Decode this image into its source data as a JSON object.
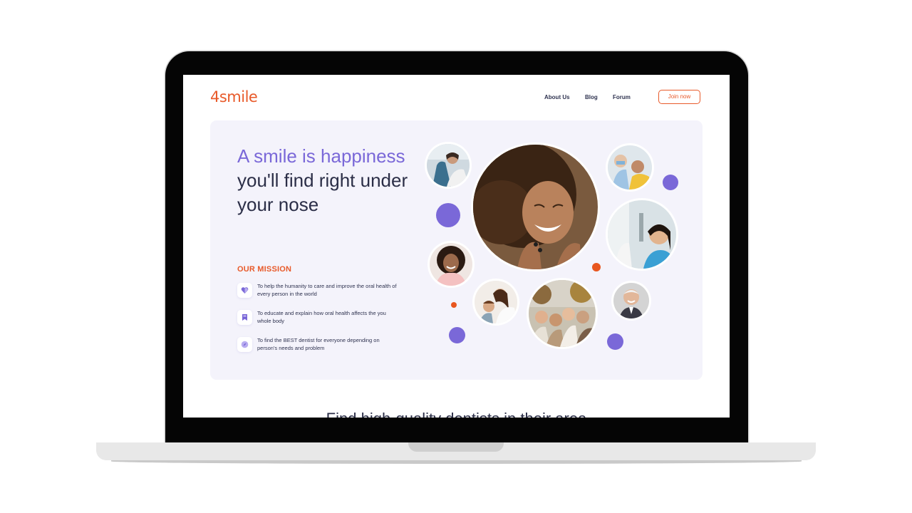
{
  "brand": {
    "logo_text": "4smile",
    "accent_color": "#e85a2a",
    "primary_color": "#7a68d8"
  },
  "nav": {
    "items": [
      {
        "label": "About Us"
      },
      {
        "label": "Blog"
      },
      {
        "label": "Forum"
      }
    ],
    "cta_label": "Join now"
  },
  "hero": {
    "headline_accent": "A smile is happiness",
    "headline_rest": " you'll find right under your nose",
    "mission_title": "OUR MISSION",
    "missions": [
      {
        "text": "To help the humanity to care and improve the oral health of every person in the world",
        "icon": "heart-icon"
      },
      {
        "text": "To educate and explain how oral health affects the you whole body",
        "icon": "bookmark-icon"
      },
      {
        "text": "To find the BEST dentist for everyone depending on person's needs and problem",
        "icon": "compass-icon"
      }
    ],
    "photos": [
      "woman-in-dental-chair-photo",
      "smiling-woman-curly-hair-photo",
      "man-at-dentist-photo",
      "woman-with-dentist-photo",
      "smiling-girl-photo",
      "mother-and-child-photo",
      "group-of-friends-photo",
      "elderly-man-smiling-photo"
    ]
  },
  "next_section": {
    "heading": "Find high-quality dentists in their area"
  }
}
